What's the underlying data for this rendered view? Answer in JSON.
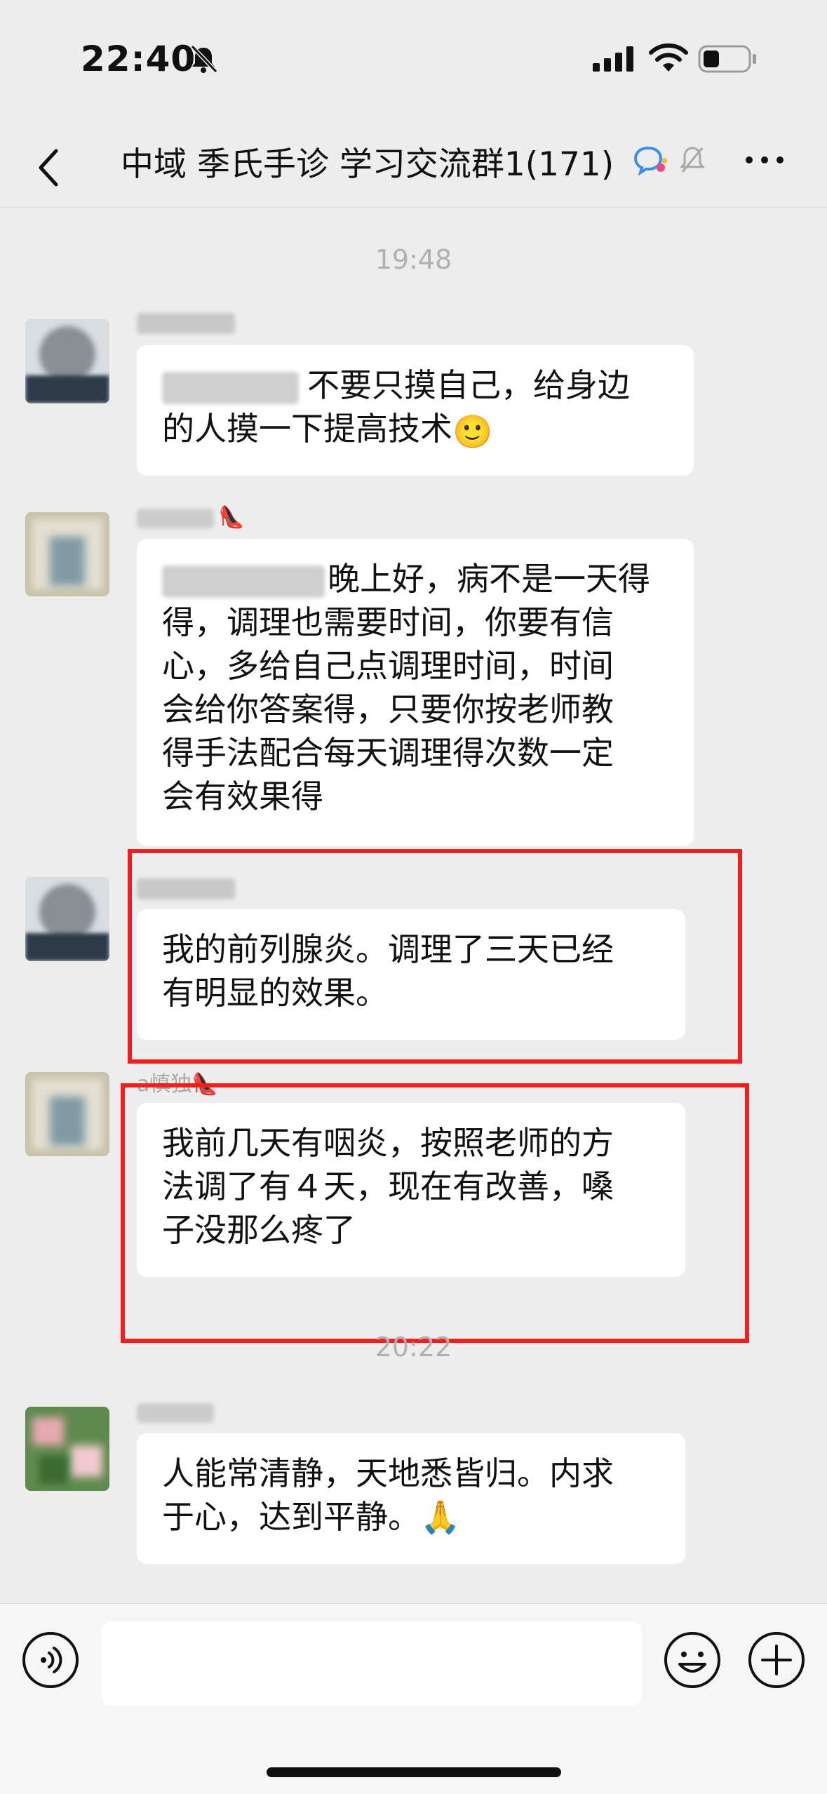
{
  "status_bar": {
    "time": "22:40"
  },
  "nav": {
    "title": "中域 季氏手诊 学习交流群1(171)"
  },
  "timestamps": [
    "19:48",
    "20:22"
  ],
  "messages": [
    {
      "sender": "",
      "lines": [
        "不要只摸自己，给身边",
        "的人摸一下提高技术"
      ],
      "emoji": "🙂"
    },
    {
      "sender": "",
      "lines": [
        "晚上好，病不是一天得",
        "得，调理也需要时间，你要有信",
        "心，多给自己点调理时间，时间",
        "会给你答案得，只要你按老师教",
        "得手法配合每天调理得次数一定",
        "会有效果得"
      ]
    },
    {
      "sender": "",
      "lines": [
        "我的前列腺炎。调理了三天已经",
        "有明显的效果。"
      ]
    },
    {
      "sender": "a慎独👠",
      "lines": [
        "我前几天有咽炎，按照老师的方",
        "法调了有４天，现在有改善，嗓",
        "子没那么疼了"
      ]
    },
    {
      "sender": "",
      "lines": [
        "人能常清静，天地悉皆归。内求",
        "于心，达到平静。🙏"
      ]
    }
  ],
  "colors": {
    "background": "#ededed",
    "bubble": "#ffffff",
    "highlight": "#f21d1d"
  },
  "icons": [
    "bell-off-icon",
    "signal-icon",
    "wifi-icon",
    "battery-icon",
    "back-icon",
    "chat-ai-icon",
    "mute-icon",
    "more-icon",
    "voice-icon",
    "emoji-icon",
    "plus-icon"
  ]
}
